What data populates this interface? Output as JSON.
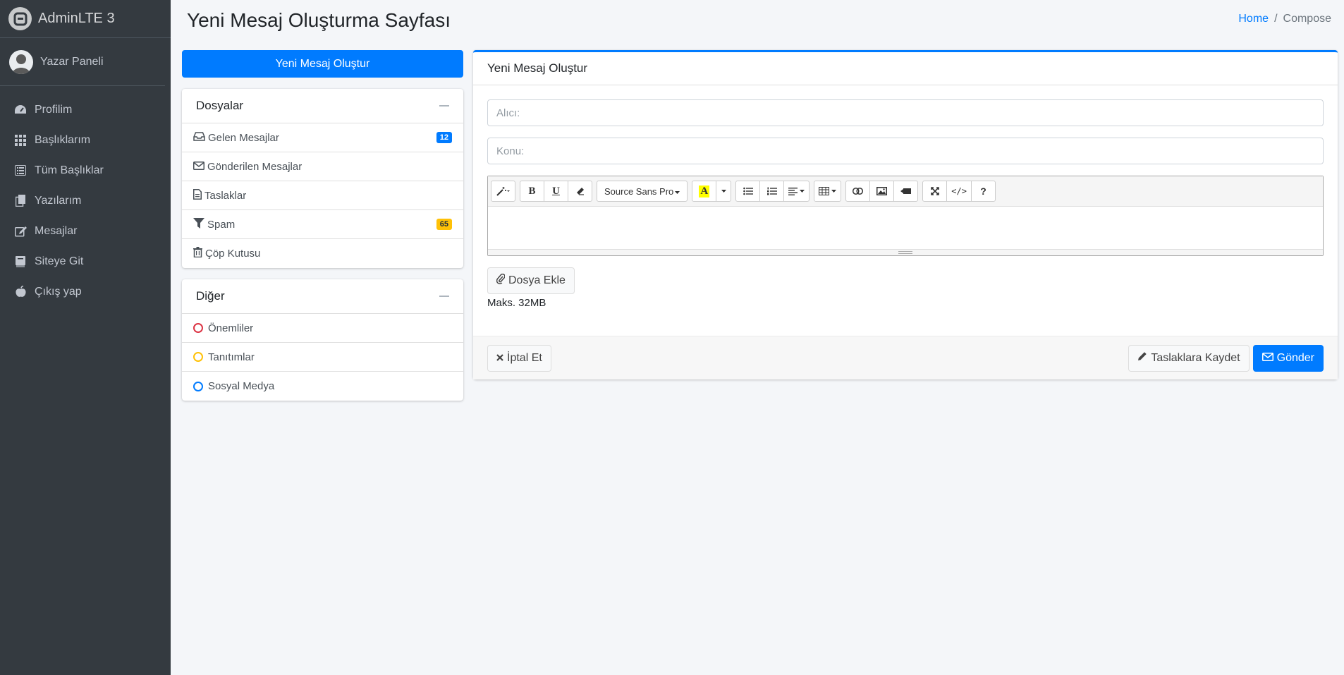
{
  "brand": {
    "name": "AdminLTE 3"
  },
  "user": {
    "name": "Yazar Paneli"
  },
  "sidebar": {
    "items": [
      {
        "label": "Profilim",
        "icon": "dashboard-icon"
      },
      {
        "label": "Başlıklarım",
        "icon": "grid-icon"
      },
      {
        "label": "Tüm Başlıklar",
        "icon": "list-icon"
      },
      {
        "label": "Yazılarım",
        "icon": "copy-icon"
      },
      {
        "label": "Mesajlar",
        "icon": "edit-icon"
      },
      {
        "label": "Siteye Git",
        "icon": "book-icon"
      },
      {
        "label": "Çıkış yap",
        "icon": "apple-icon"
      }
    ]
  },
  "header": {
    "title": "Yeni Mesaj Oluşturma Sayfası",
    "breadcrumb": {
      "home": "Home",
      "current": "Compose"
    }
  },
  "compose_button": {
    "label": "Yeni Mesaj Oluştur"
  },
  "folders": {
    "title": "Dosyalar",
    "items": [
      {
        "label": "Gelen Mesajlar",
        "icon": "inbox-icon",
        "badge": "12"
      },
      {
        "label": "Gönderilen Mesajlar",
        "icon": "envelope-icon"
      },
      {
        "label": "Taslaklar",
        "icon": "file-icon"
      },
      {
        "label": "Spam",
        "icon": "filter-icon",
        "badge": "65"
      },
      {
        "label": "Çöp Kutusu",
        "icon": "trash-icon"
      }
    ]
  },
  "labels": {
    "title": "Diğer",
    "items": [
      {
        "label": "Önemliler",
        "color": "#dc3545"
      },
      {
        "label": "Tanıtımlar",
        "color": "#ffc107"
      },
      {
        "label": "Sosyal Medya",
        "color": "#007bff"
      }
    ]
  },
  "compose": {
    "title": "Yeni Mesaj Oluştur",
    "to_placeholder": "Alıcı:",
    "subject_placeholder": "Konu:",
    "font_name": "Source Sans Pro",
    "attach_label": "Dosya Ekle",
    "max_size": "Maks. 32MB",
    "cancel_label": "İptal Et",
    "draft_label": "Taslaklara Kaydet",
    "send_label": "Gönder"
  },
  "colors": {
    "primary": "#007bff",
    "sidebar": "#343a40",
    "warning": "#ffc107"
  }
}
